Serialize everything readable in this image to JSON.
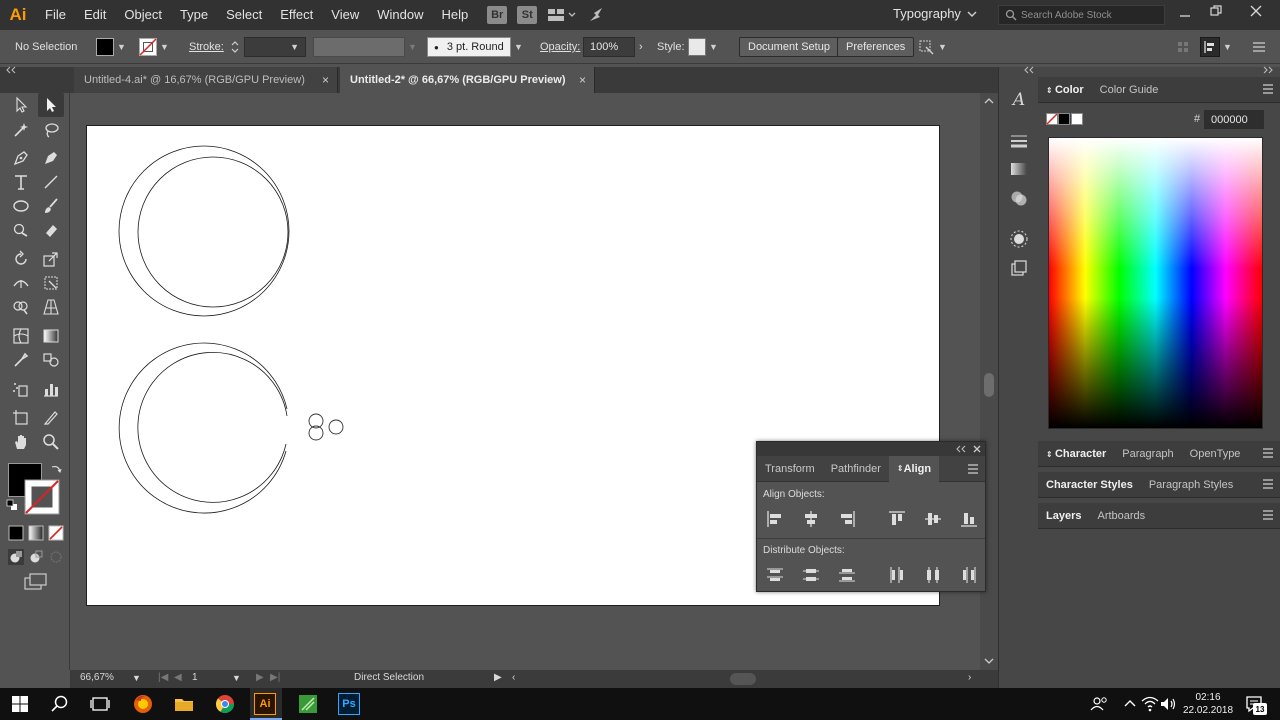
{
  "menubar": {
    "logo": "Ai",
    "items": [
      "File",
      "Edit",
      "Object",
      "Type",
      "Select",
      "Effect",
      "View",
      "Window",
      "Help"
    ],
    "bridge_label": "Br",
    "stock_label": "St",
    "workspace": "Typography",
    "search_placeholder": "Search Adobe Stock"
  },
  "control_bar": {
    "selection": "No Selection",
    "stroke_label": "Stroke:",
    "brush": "3 pt. Round",
    "opacity_label": "Opacity:",
    "opacity_value": "100%",
    "style_label": "Style:",
    "document_setup": "Document Setup",
    "preferences": "Preferences"
  },
  "tabs": [
    {
      "label": "Untitled-4.ai* @ 16,67% (RGB/GPU Preview)",
      "active": false
    },
    {
      "label": "Untitled-2* @ 66,67% (RGB/GPU Preview)",
      "active": true
    }
  ],
  "tab_close": "×",
  "status_bar": {
    "zoom": "66,67%",
    "artboard": "1",
    "tool": "Direct Selection"
  },
  "color_panel": {
    "tabs": [
      "Color",
      "Color Guide"
    ],
    "hex_label": "#",
    "hex_value": "000000"
  },
  "character_panel": {
    "tabs": [
      "Character",
      "Paragraph",
      "OpenType"
    ]
  },
  "styles_panel": {
    "tabs": [
      "Character Styles",
      "Paragraph Styles"
    ]
  },
  "layers_panel": {
    "tabs": [
      "Layers",
      "Artboards"
    ]
  },
  "align_panel": {
    "tabs": [
      "Transform",
      "Pathfinder",
      "Align"
    ],
    "align_objects_label": "Align Objects:",
    "distribute_objects_label": "Distribute Objects:"
  },
  "taskbar": {
    "time": "02:16",
    "date": "22.02.2018",
    "notification_count": "13",
    "ai_label": "Ai",
    "ps_label": "Ps"
  },
  "colors": {
    "ai_orange": "#ff9a00",
    "ps_blue": "#31a8ff"
  }
}
